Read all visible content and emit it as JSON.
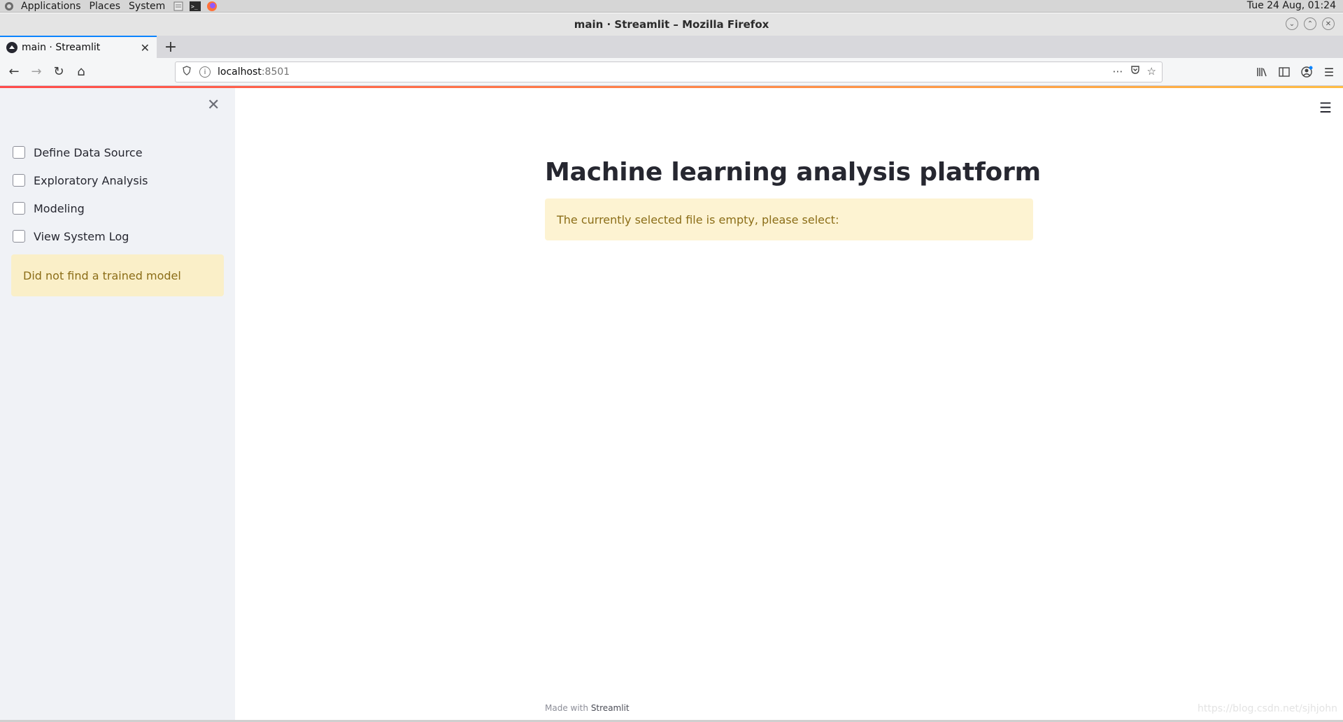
{
  "desktop": {
    "menus": [
      "Applications",
      "Places",
      "System"
    ],
    "clock": "Tue 24 Aug, 01:24"
  },
  "window": {
    "title": "main · Streamlit – Mozilla Firefox"
  },
  "browser": {
    "tab_label": "main · Streamlit",
    "url_host": "localhost",
    "url_port": ":8501"
  },
  "sidebar": {
    "items": [
      {
        "label": "Define Data Source",
        "checked": false
      },
      {
        "label": "Exploratory Analysis",
        "checked": false
      },
      {
        "label": "Modeling",
        "checked": false
      },
      {
        "label": "View System Log",
        "checked": false
      }
    ],
    "alert": "Did not find a trained model"
  },
  "main": {
    "title": "Machine learning analysis platform",
    "alert": "The currently selected file is empty, please select:",
    "footer_prefix": "Made with",
    "footer_brand": "Streamlit",
    "watermark": "https://blog.csdn.net/sjhjohn"
  },
  "colors": {
    "sidebar_bg": "#f0f2f6",
    "warning_bg": "#fdf3d2",
    "warning_text": "#8b6d17",
    "accent_red": "#ff4b4b"
  }
}
